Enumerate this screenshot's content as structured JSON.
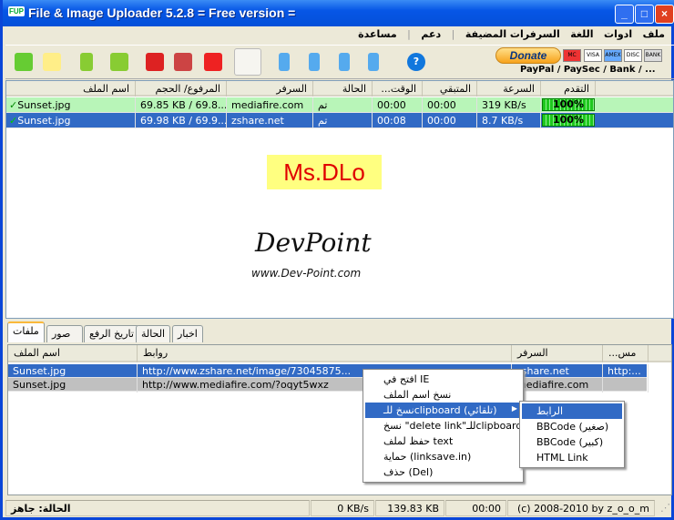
{
  "window": {
    "title": "File & Image Uploader 5.2.8  = Free version =",
    "logo": "FUP",
    "min": "_",
    "max": "□",
    "close": "×"
  },
  "menu": [
    "ملف",
    "ادوات",
    "اللغة",
    "السرفرات المضيفة",
    "دعم",
    "مساعدة"
  ],
  "toolbar": {
    "icons": [
      "add-icon",
      "add-folder-icon",
      "upload-icon",
      "resume-upload-icon",
      "stop-one-icon",
      "move-icon",
      "stop-icon",
      "settings-icon",
      "move-top-icon",
      "move-up-icon",
      "move-down-icon",
      "move-bottom-icon",
      "help-icon"
    ],
    "donate": "Donate",
    "cards": [
      "MC",
      "VISA",
      "AMEX",
      "DISC",
      "BANK"
    ],
    "payment_text": "PayPal / PaySec / Bank / ..."
  },
  "uploads": {
    "columns": [
      "اسم الملف",
      "المرفوع/ الحجم",
      "السرفر",
      "الحالة",
      "...الوقت",
      "المتبقي",
      "السرعة",
      "التقدم"
    ],
    "rows": [
      {
        "name": "Sunset.jpg",
        "size": "69.85 KB / 69.8...",
        "server": "mediafire.com",
        "status": "تم",
        "time": "00:00",
        "remaining": "00:00",
        "speed": "319 KB/s",
        "progress": "100%"
      },
      {
        "name": "Sunset.jpg",
        "size": "69.98 KB / 69.9...",
        "server": "zshare.net",
        "status": "تم",
        "time": "00:08",
        "remaining": "00:00",
        "speed": "8.7 KB/s",
        "progress": "100%"
      }
    ]
  },
  "watermark": {
    "label": "Ms.DLo",
    "logo": "DevPoint",
    "url": "www.Dev-Point.com"
  },
  "tabs": [
    "ملفات",
    "صور",
    "تاريخ الرفع",
    "الحالة",
    "اخبار"
  ],
  "links": {
    "columns": [
      "اسم الملف",
      "روابط",
      "السرفر",
      "...مس"
    ],
    "rows": [
      {
        "name": "Sunset.jpg",
        "link": "http://www.zshare.net/image/73045875...",
        "server": "zshare.net",
        "extra": "http:..."
      },
      {
        "name": "Sunset.jpg",
        "link": "http://www.mediafire.com/?oqyt5wxz",
        "server": "mediafire.com",
        "extra": ""
      }
    ]
  },
  "context_menu": [
    "افتح في IE",
    "نسخ اسم الملف",
    "نسخ للـclipboard (تلقائي)",
    "نسخ \"delete link\"للـclipboard",
    "حفظ لملف text",
    "حماية (linksave.in)",
    "حذف (Del)"
  ],
  "submenu": [
    "الرابط",
    "BBCode (صغير)",
    "BBCode (كبير)",
    "HTML Link"
  ],
  "status": {
    "state": "الحالة: جاهز",
    "speed": "0 KB/s",
    "total": "139.83 KB",
    "time": "00:00",
    "copyright": "(c) 2008-2010 by z_o_o_m"
  }
}
